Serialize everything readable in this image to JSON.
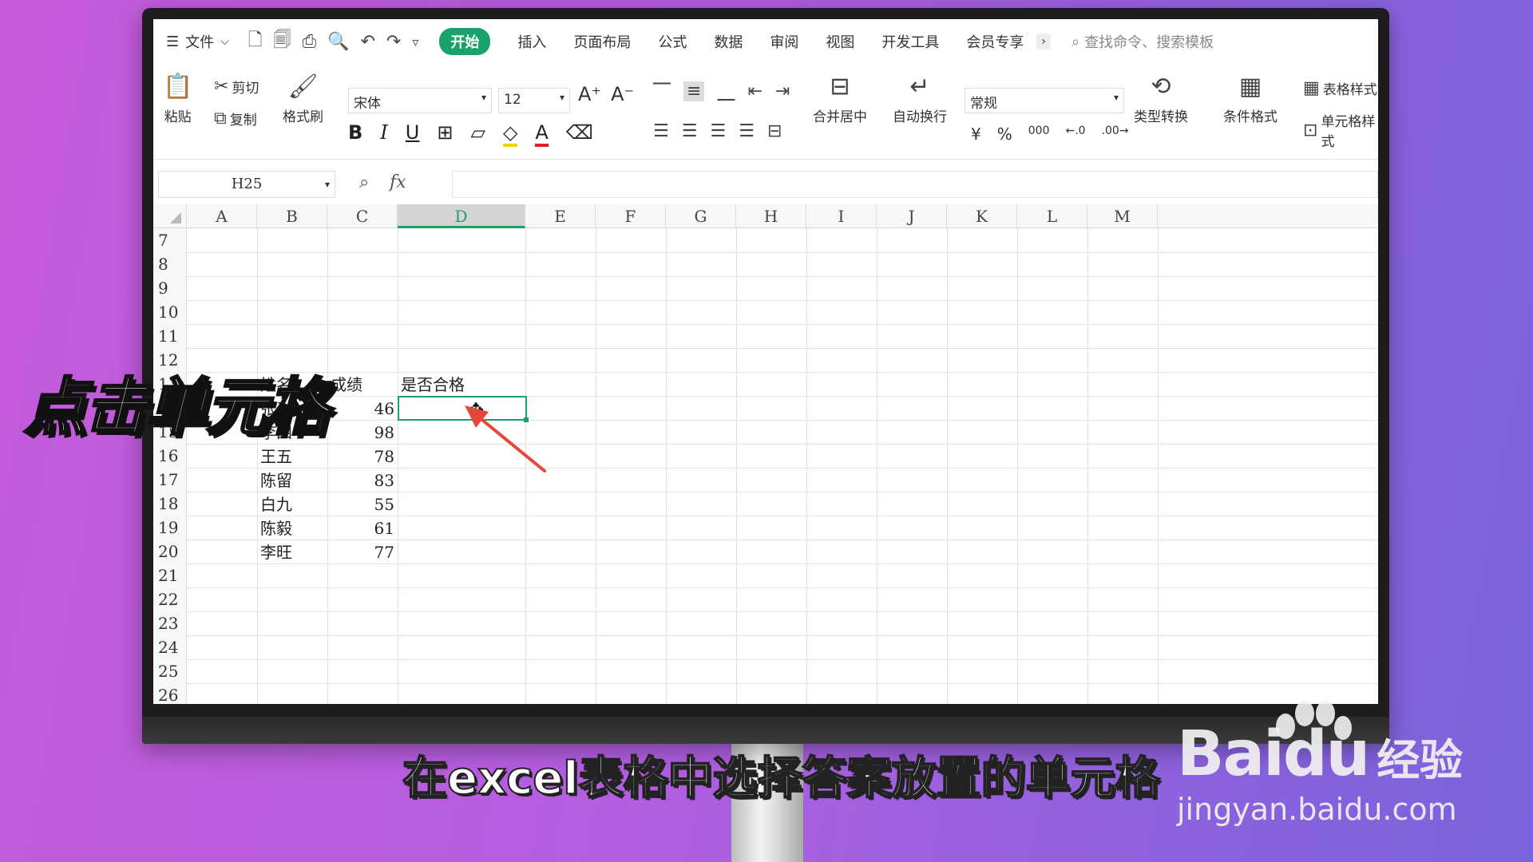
{
  "menu": {
    "file_label": "文件",
    "tabs": [
      "开始",
      "插入",
      "页面布局",
      "公式",
      "数据",
      "审阅",
      "视图",
      "开发工具",
      "会员专享"
    ],
    "active_tab": "开始",
    "search_placeholder": "查找命令、搜索模板"
  },
  "ribbon": {
    "paste": "粘贴",
    "cut": "剪切",
    "copy": "复制",
    "format_painter": "格式刷",
    "font_name": "宋体",
    "font_size": "12",
    "merge_center": "合并居中",
    "wrap_text": "自动换行",
    "number_format": "常规",
    "type_convert": "类型转换",
    "conditional_format": "条件格式",
    "table_style": "表格样式",
    "cell_style": "单元格样式"
  },
  "formula_bar": {
    "name_box": "H25",
    "fx_label": "fx",
    "formula": ""
  },
  "sheet": {
    "columns": [
      "A",
      "B",
      "C",
      "D",
      "E",
      "F",
      "G",
      "H",
      "I",
      "J",
      "K",
      "L",
      "M"
    ],
    "selected_column": "D",
    "rows": [
      "7",
      "8",
      "9",
      "10",
      "11",
      "12",
      "13",
      "14",
      "15",
      "16",
      "17",
      "18",
      "19",
      "20",
      "21",
      "22",
      "23",
      "24",
      "25",
      "26"
    ],
    "header_row": {
      "name": "姓名",
      "score": "成绩",
      "pass": "是否合格"
    },
    "records": [
      {
        "name": "张三",
        "score": "46"
      },
      {
        "name": "李四",
        "score": "98"
      },
      {
        "name": "王五",
        "score": "78"
      },
      {
        "name": "陈留",
        "score": "83"
      },
      {
        "name": "白九",
        "score": "55"
      },
      {
        "name": "陈毅",
        "score": "61"
      },
      {
        "name": "李旺",
        "score": "77"
      }
    ]
  },
  "overlay": {
    "title": "点击单元格",
    "subtitle": "在excel表格中选择答案放置的单元格"
  },
  "watermark": {
    "brand": "Baidu",
    "product": "经验",
    "url": "jingyan.baidu.com"
  },
  "colors": {
    "accent_green": "#1f9e6d",
    "tab_active_bg": "#18a36a",
    "arrow_red": "#e5483a"
  }
}
